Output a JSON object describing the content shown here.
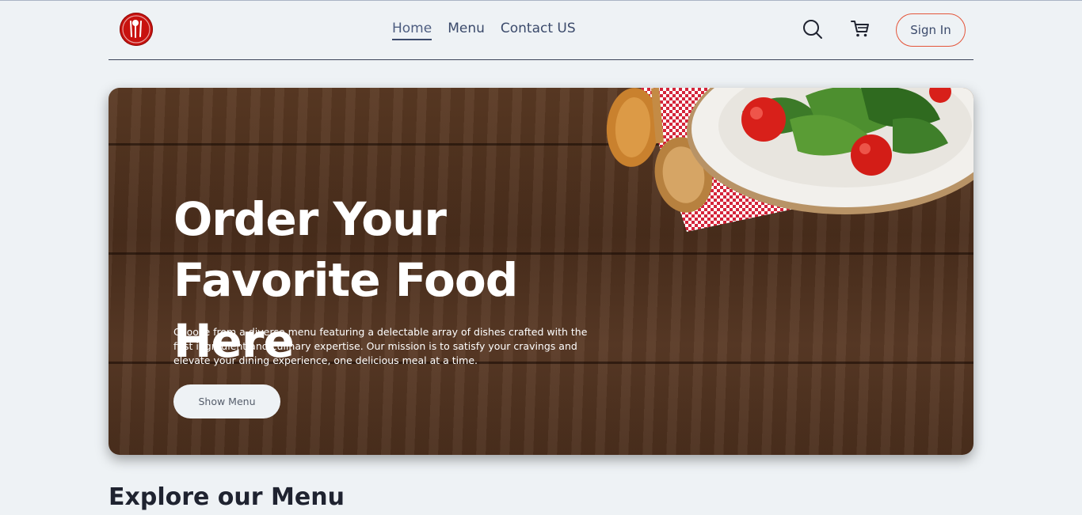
{
  "nav": {
    "links": [
      {
        "label": "Home",
        "active": true
      },
      {
        "label": "Menu",
        "active": false
      },
      {
        "label": "Contact US",
        "active": false
      }
    ],
    "signin_label": "Sign In"
  },
  "hero": {
    "title": "Order Your Favorite Food Here",
    "description": "Choose from a diverse menu featuring a delectable array of dishes crafted with the first ingredient and culinary expertise. Our mission is to satisfy your cravings and elevate your dining experience, one delicious meal at a time.",
    "button_label": "Show Menu"
  },
  "sections": {
    "explore_title": "Explore our Menu"
  },
  "icons": {
    "logo": "utensils-logo-icon",
    "search": "search-icon",
    "cart": "cart-icon"
  },
  "colors": {
    "brand": "#c8120f",
    "accent": "#e4553a",
    "nav_text": "#3b4a6b",
    "background": "#eef2f5"
  }
}
